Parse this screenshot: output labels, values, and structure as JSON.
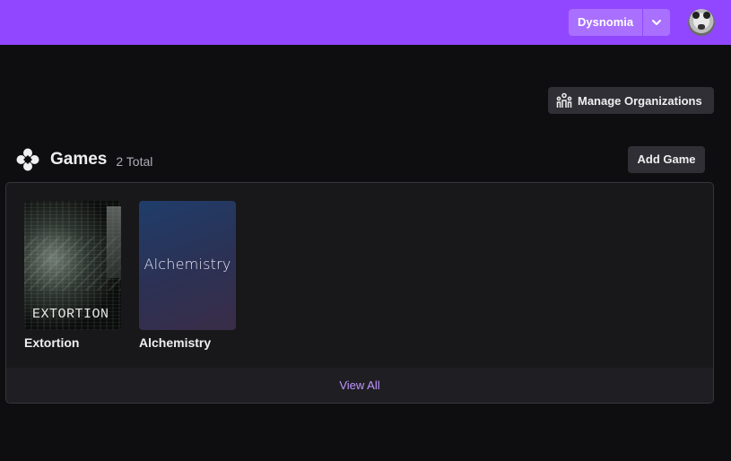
{
  "topbar": {
    "org_name": "Dysnomia",
    "caret_icon": "chevron-down-icon",
    "avatar_icon": "user-avatar",
    "accent": "#9147ff"
  },
  "manage": {
    "label": "Manage Organizations",
    "icon": "organization-icon"
  },
  "games": {
    "icon": "gamepad-icon",
    "title": "Games",
    "count": "2 Total",
    "add_label": "Add Game",
    "items": [
      {
        "title": "Extortion",
        "cover_text": "EXTORTION"
      },
      {
        "title": "Alchemistry",
        "cover_text": "Alchemistry"
      }
    ],
    "view_all": "View All"
  }
}
